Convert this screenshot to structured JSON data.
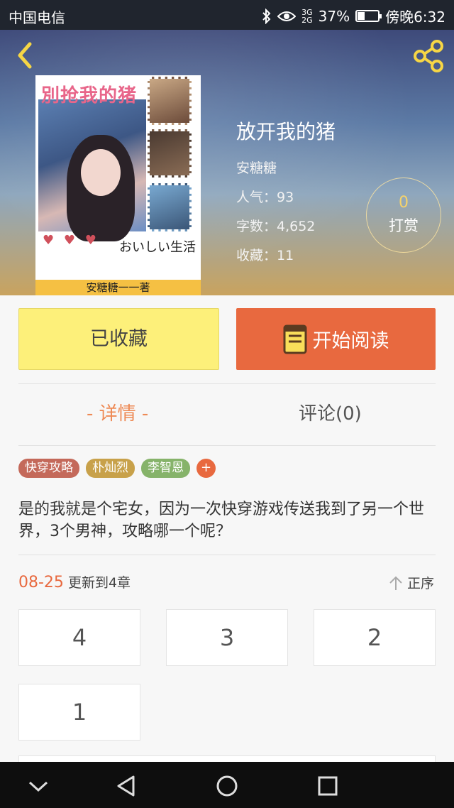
{
  "status_bar": {
    "carrier": "中国电信",
    "network_top": "3G",
    "network_bottom": "2G",
    "battery": "37%",
    "battery_level": 0.37,
    "time": "傍晚6:32"
  },
  "cover": {
    "title_art": "別抢我的猪",
    "author_strip": "安糖糖一一著",
    "japanese_text": "おいしい生活"
  },
  "book": {
    "title": "放开我的猪",
    "author": "安糖糖",
    "popularity": "人气：93",
    "word_count": "字数：4,652",
    "favorites": "收藏：11"
  },
  "reward": {
    "count": "0",
    "label": "打赏"
  },
  "actions": {
    "collect_label": "已收藏",
    "read_label": "开始阅读"
  },
  "tabs": {
    "detail": "- 详情 -",
    "comment": "评论(0)"
  },
  "tags": [
    {
      "label": "快穿攻略",
      "color": "#c4695a"
    },
    {
      "label": "朴灿烈",
      "color": "#c8a14a"
    },
    {
      "label": "李智恩",
      "color": "#86b36a"
    }
  ],
  "tag_more": "+",
  "description": "是的我就是个宅女，因为一次快穿游戏传送我到了另一个世界，3个男神，攻略哪一个呢？",
  "update": {
    "date": "08-25",
    "text": "更新到4章",
    "order_label": "正序"
  },
  "chapters": [
    "4",
    "3",
    "2",
    "1"
  ],
  "colors": {
    "accent_orange": "#e8693f",
    "collect_yellow": "#fdf07a"
  }
}
